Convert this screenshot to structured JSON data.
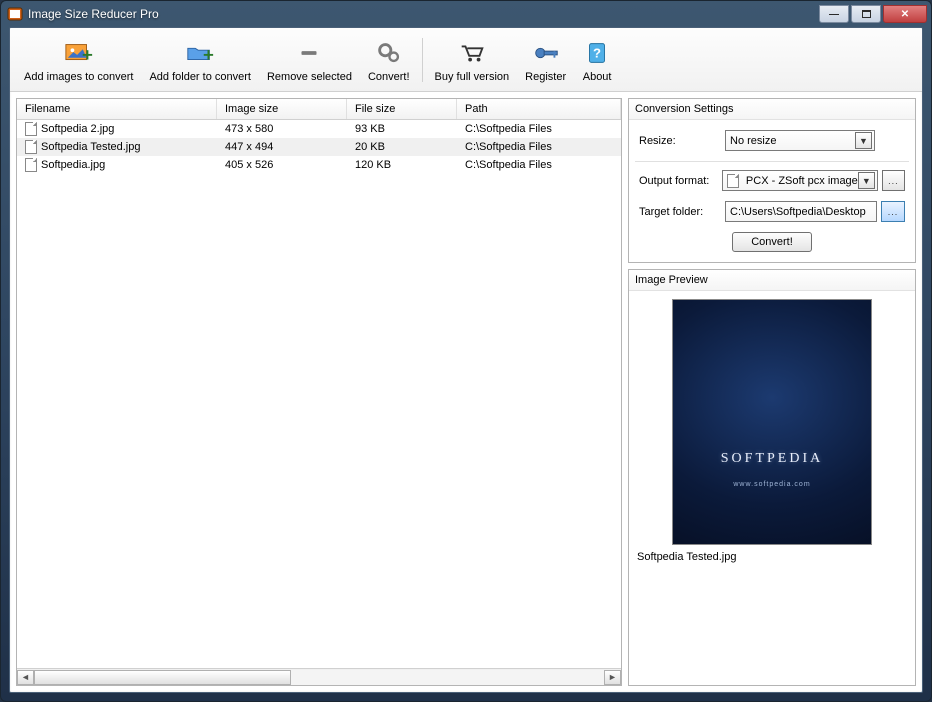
{
  "window": {
    "title": "Image Size Reducer Pro"
  },
  "toolbar": {
    "add_images": "Add images to convert",
    "add_folder": "Add folder to convert",
    "remove_selected": "Remove selected",
    "convert": "Convert!",
    "buy_full": "Buy full version",
    "register": "Register",
    "about": "About"
  },
  "list": {
    "headers": {
      "filename": "Filename",
      "image_size": "Image size",
      "file_size": "File size",
      "path": "Path"
    },
    "rows": [
      {
        "filename": "Softpedia 2.jpg",
        "image_size": "473 x 580",
        "file_size": "93 KB",
        "path": "C:\\Softpedia Files",
        "selected": false
      },
      {
        "filename": "Softpedia Tested.jpg",
        "image_size": "447 x 494",
        "file_size": "20 KB",
        "path": "C:\\Softpedia Files",
        "selected": true
      },
      {
        "filename": "Softpedia.jpg",
        "image_size": "405 x 526",
        "file_size": "120 KB",
        "path": "C:\\Softpedia Files",
        "selected": false
      }
    ]
  },
  "settings": {
    "panel_title": "Conversion Settings",
    "resize_label": "Resize:",
    "resize_value": "No resize",
    "output_label": "Output format:",
    "output_value": "PCX - ZSoft pcx image",
    "target_label": "Target folder:",
    "target_value": "C:\\Users\\Softpedia\\Desktop",
    "browse_label": "...",
    "convert_button": "Convert!"
  },
  "preview": {
    "panel_title": "Image Preview",
    "watermark": "SOFTPEDIA",
    "watermark_url": "www.softpedia.com",
    "caption": "Softpedia Tested.jpg"
  }
}
